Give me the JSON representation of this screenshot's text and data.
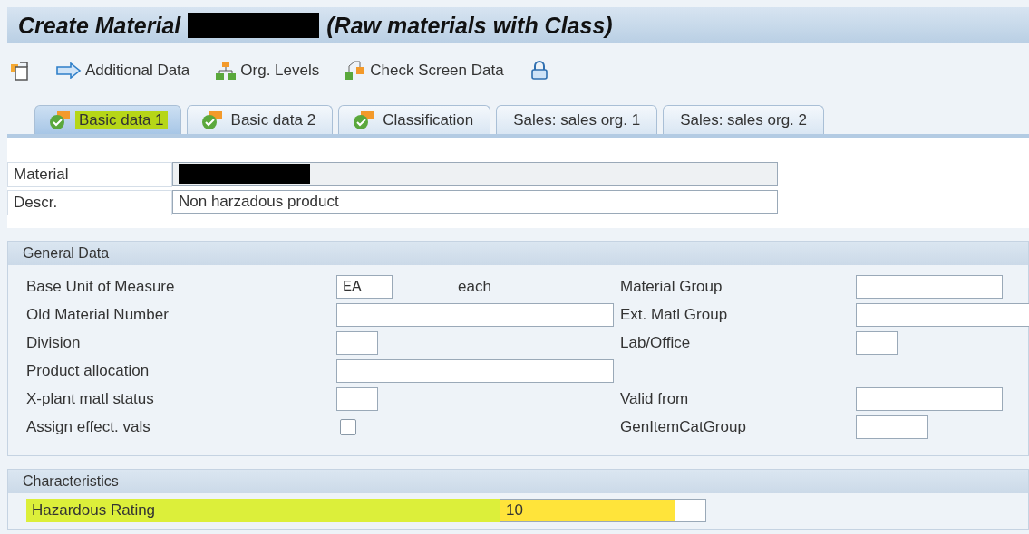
{
  "window": {
    "title": "Create Material",
    "title_redacted": true,
    "title_rest": "(Raw materials with Class)"
  },
  "toolbar": [
    {
      "kind": "doc"
    },
    {
      "kind": "arrow",
      "label": "Additional Data"
    },
    {
      "kind": "hierarchy",
      "label": "Org. Levels"
    },
    {
      "kind": "check",
      "label": "Check Screen Data"
    },
    {
      "kind": "lock"
    }
  ],
  "tabs": [
    {
      "label": "Basic data 1",
      "selected": true,
      "highlighted": true,
      "kind": "status"
    },
    {
      "label": "Basic data 2",
      "selected": false,
      "highlighted": false,
      "kind": "status"
    },
    {
      "label": "Classification",
      "selected": false,
      "highlighted": false,
      "kind": "status"
    },
    {
      "label": "Sales: sales org. 1",
      "selected": false,
      "highlighted": false,
      "kind": "plain"
    },
    {
      "label": "Sales: sales org. 2",
      "selected": false,
      "highlighted": false,
      "kind": "plain"
    }
  ],
  "header": [
    {
      "label": "Material",
      "redacted": true
    },
    {
      "label": "Descr.",
      "value": "Non harzadous product"
    }
  ],
  "general_data": {
    "title": "General Data",
    "left": [
      {
        "label": "Base Unit of Measure",
        "kind": "unit",
        "value": "EA",
        "unit_text": "each"
      },
      {
        "label": "Old Material Number",
        "kind": "long"
      },
      {
        "label": "Division",
        "kind": "tiny"
      },
      {
        "label": "Product allocation",
        "kind": "long"
      },
      {
        "label": "X-plant matl status",
        "kind": "tiny"
      },
      {
        "label": "Assign effect. vals",
        "kind": "checkbox",
        "checked": false
      }
    ],
    "right": [
      {
        "label": "Material Group",
        "kind": "medium"
      },
      {
        "label": "Ext. Matl Group",
        "kind": "wide"
      },
      {
        "label": "Lab/Office",
        "kind": "tiny"
      },
      {
        "kind": "empty"
      },
      {
        "label": "Valid from",
        "kind": "medium"
      },
      {
        "label": "GenItemCatGroup",
        "kind": "short"
      }
    ]
  },
  "characteristics": {
    "title": "Characteristics",
    "rows": [
      {
        "label": "Hazardous Rating",
        "value": "10",
        "highlighted": true
      }
    ]
  }
}
